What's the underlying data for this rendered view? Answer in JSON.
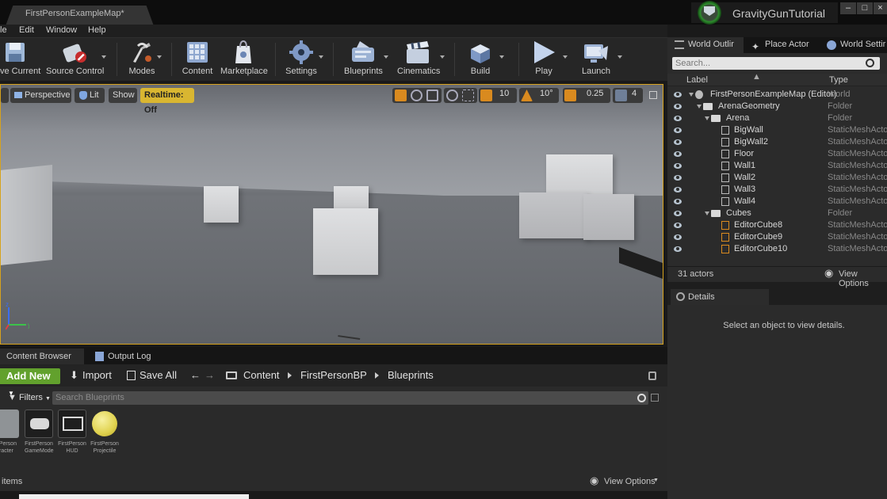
{
  "window": {
    "doc_tab": "FirstPersonExampleMap*",
    "project_name": "GravityGunTutorial",
    "left_stub": "",
    "minimize": "–",
    "maximize": "□",
    "close": "×"
  },
  "menu": [
    "le",
    "Edit",
    "Window",
    "Help"
  ],
  "toolbar": {
    "save_current": "ve Current",
    "source_control": "Source Control",
    "modes": "Modes",
    "content": "Content",
    "marketplace": "Marketplace",
    "settings": "Settings",
    "blueprints": "Blueprints",
    "cinematics": "Cinematics",
    "build": "Build",
    "play": "Play",
    "launch": "Launch"
  },
  "viewport": {
    "perspective": "Perspective",
    "lit": "Lit",
    "show": "Show",
    "realtime": "Realtime: Off",
    "grid_snap": "10",
    "rot_snap": "10°",
    "scale_snap": "0.25",
    "camera_speed": "4",
    "axis_x": "x",
    "axis_y": "y",
    "axis_z": "z"
  },
  "right_tabs": {
    "world_outliner": "World Outlir",
    "place_actor": "Place Actor",
    "world_settings": "World Settir"
  },
  "outliner": {
    "search_placeholder": "Search...",
    "col_label": "Label",
    "col_type": "Type",
    "rows": [
      {
        "label": "FirstPersonExampleMap (Editor)",
        "type": "World"
      },
      {
        "label": "ArenaGeometry",
        "type": "Folder"
      },
      {
        "label": "Arena",
        "type": "Folder"
      },
      {
        "label": "BigWall",
        "type": "StaticMeshActo"
      },
      {
        "label": "BigWall2",
        "type": "StaticMeshActo"
      },
      {
        "label": "Floor",
        "type": "StaticMeshActo"
      },
      {
        "label": "Wall1",
        "type": "StaticMeshActo"
      },
      {
        "label": "Wall2",
        "type": "StaticMeshActo"
      },
      {
        "label": "Wall3",
        "type": "StaticMeshActo"
      },
      {
        "label": "Wall4",
        "type": "StaticMeshActo"
      },
      {
        "label": "Cubes",
        "type": "Folder"
      },
      {
        "label": "EditorCube8",
        "type": "StaticMeshActo"
      },
      {
        "label": "EditorCube9",
        "type": "StaticMeshActo"
      },
      {
        "label": "EditorCube10",
        "type": "StaticMeshActo"
      }
    ],
    "actor_count": "31 actors",
    "view_options": "View Options"
  },
  "details": {
    "tab": "Details",
    "empty_message": "Select an object to view details."
  },
  "content_browser": {
    "tab": "Content Browser",
    "output_log_tab": "Output Log",
    "add_new": "Add New",
    "import": "Import",
    "save_all": "Save All",
    "path": [
      "Content",
      "FirstPersonBP",
      "Blueprints"
    ],
    "filters": "Filters",
    "search_placeholder": "Search Blueprints",
    "assets": [
      {
        "line1": "rstPerson",
        "line2": "aracter"
      },
      {
        "line1": "FirstPerson",
        "line2": "GameMode"
      },
      {
        "line1": "FirstPerson",
        "line2": "HUD"
      },
      {
        "line1": "FirstPerson",
        "line2": "Projectile"
      }
    ],
    "items_label": "items",
    "view_options": "View Options"
  }
}
